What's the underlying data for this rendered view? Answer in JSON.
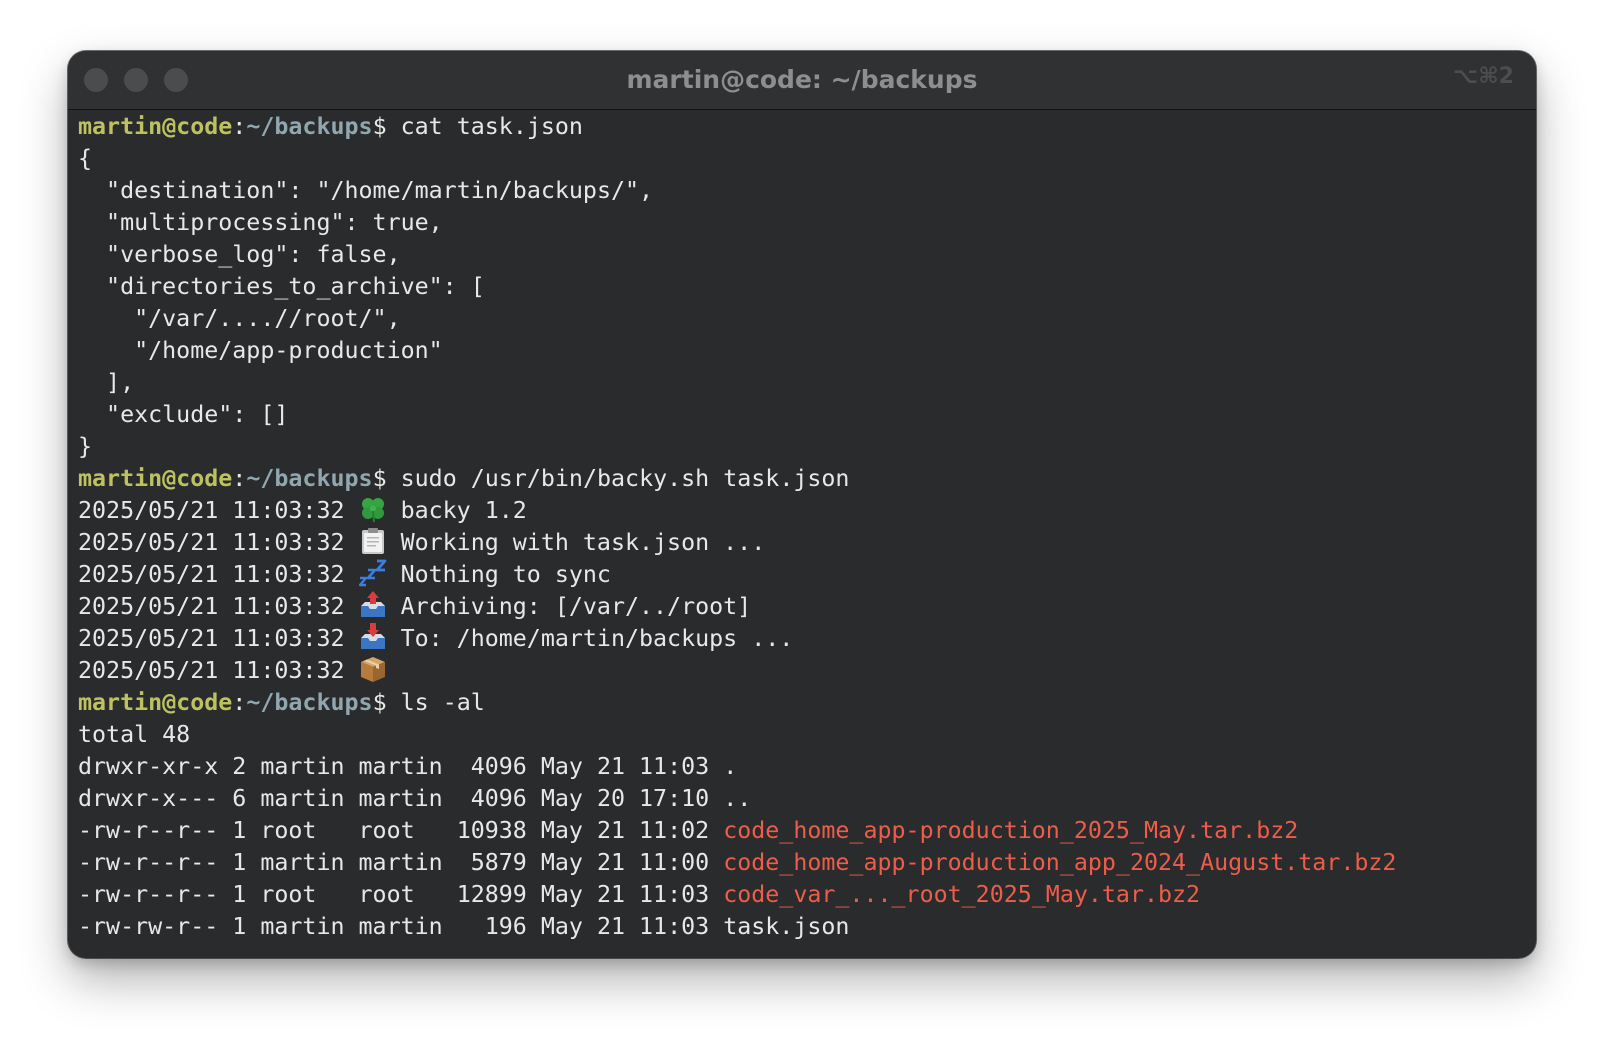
{
  "window": {
    "title": "martin@code: ~/backups",
    "shortcut": "⌥⌘2"
  },
  "prompt": {
    "user": "martin@code",
    "sep": ":",
    "path": "~/backups",
    "symbol": "$ "
  },
  "commands": {
    "cat": "cat task.json",
    "backy": "sudo /usr/bin/backy.sh task.json",
    "ls": "ls -al"
  },
  "json_output": [
    "{",
    "  \"destination\": \"/home/martin/backups/\",",
    "  \"multiprocessing\": true,",
    "  \"verbose_log\": false,",
    "  \"directories_to_archive\": [",
    "    \"/var/....//root/\",",
    "    \"/home/app-production\"",
    "  ],",
    "  \"exclude\": []",
    "}"
  ],
  "log": [
    {
      "timestamp": "2025/05/21 11:03:32",
      "icon": "four-leaf-clover-icon",
      "message": "backy 1.2"
    },
    {
      "timestamp": "2025/05/21 11:03:32",
      "icon": "clipboard-icon",
      "message": "Working with task.json ..."
    },
    {
      "timestamp": "2025/05/21 11:03:32",
      "icon": "zzz-sleep-icon",
      "message": "Nothing to sync"
    },
    {
      "timestamp": "2025/05/21 11:03:32",
      "icon": "outbox-tray-icon",
      "message": "Archiving: [/var/../root]"
    },
    {
      "timestamp": "2025/05/21 11:03:32",
      "icon": "inbox-tray-icon",
      "message": "To: /home/martin/backups ..."
    },
    {
      "timestamp": "2025/05/21 11:03:32",
      "icon": "package-icon",
      "message": ""
    }
  ],
  "ls_total": "total 48",
  "ls_rows": [
    {
      "meta": "drwxr-xr-x 2 martin martin  4096 May 21 11:03 ",
      "name": ".",
      "archive": false
    },
    {
      "meta": "drwxr-x--- 6 martin martin  4096 May 20 17:10 ",
      "name": "..",
      "archive": false
    },
    {
      "meta": "-rw-r--r-- 1 root   root   10938 May 21 11:02 ",
      "name": "code_home_app-production_2025_May.tar.bz2",
      "archive": true
    },
    {
      "meta": "-rw-r--r-- 1 martin martin  5879 May 21 11:00 ",
      "name": "code_home_app-production_app_2024_August.tar.bz2",
      "archive": true
    },
    {
      "meta": "-rw-r--r-- 1 root   root   12899 May 21 11:03 ",
      "name": "code_var_..._root_2025_May.tar.bz2",
      "archive": true
    },
    {
      "meta": "-rw-rw-r-- 1 martin martin   196 May 21 11:03 ",
      "name": "task.json",
      "archive": false
    }
  ],
  "colors": {
    "prompt_user": "#bdc15f",
    "prompt_path": "#90a7b0",
    "archive_file": "#ee5d4a",
    "text": "#e8e8e8",
    "background": "#2a2b2c"
  }
}
